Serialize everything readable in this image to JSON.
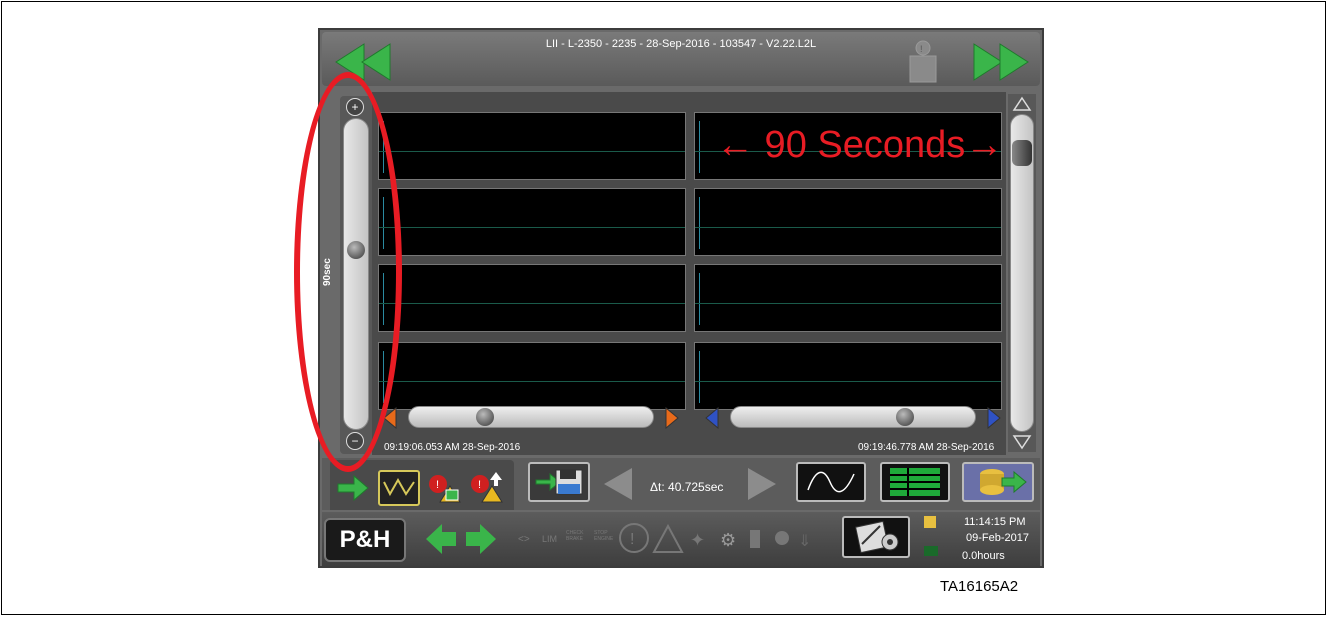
{
  "window": {
    "title": "LII - L-2350 - 2235 - 28-Sep-2016 - 103547 - V2.22.L2L"
  },
  "icons": {
    "nav_back": "double-left-arrow-icon",
    "nav_forward": "double-right-arrow-icon",
    "trash": "trash-icon"
  },
  "zoom_slider": {
    "label": "90sec",
    "zoom_in_icon": "zoom-in-icon",
    "zoom_out_icon": "zoom-out-icon",
    "level": 0.5
  },
  "timeline": {
    "left_timestamp": "09:19:06.053 AM 28-Sep-2016",
    "right_timestamp": "09:19:46.778 AM 28-Sep-2016",
    "left_slider_position": 0.2,
    "right_slider_position": 0.7
  },
  "toolbar": {
    "delta": "Δt: 40.725sec"
  },
  "bottom_bar": {
    "logo": "P&H",
    "faint_lim": "LIM",
    "faint_check": "CHECK BRAKE",
    "faint_stop": "STOP ENGINE",
    "time": "11:14:15 PM",
    "date": "09-Feb-2017",
    "hours": "0.0hours"
  },
  "annotation": {
    "callout": "← 90 Seconds→"
  },
  "figure_caption": "TA16165A2",
  "colors": {
    "annotation_red": "#e81c24",
    "nav_green": "#3ab54a",
    "trace_teal": "#2a8aa0"
  }
}
